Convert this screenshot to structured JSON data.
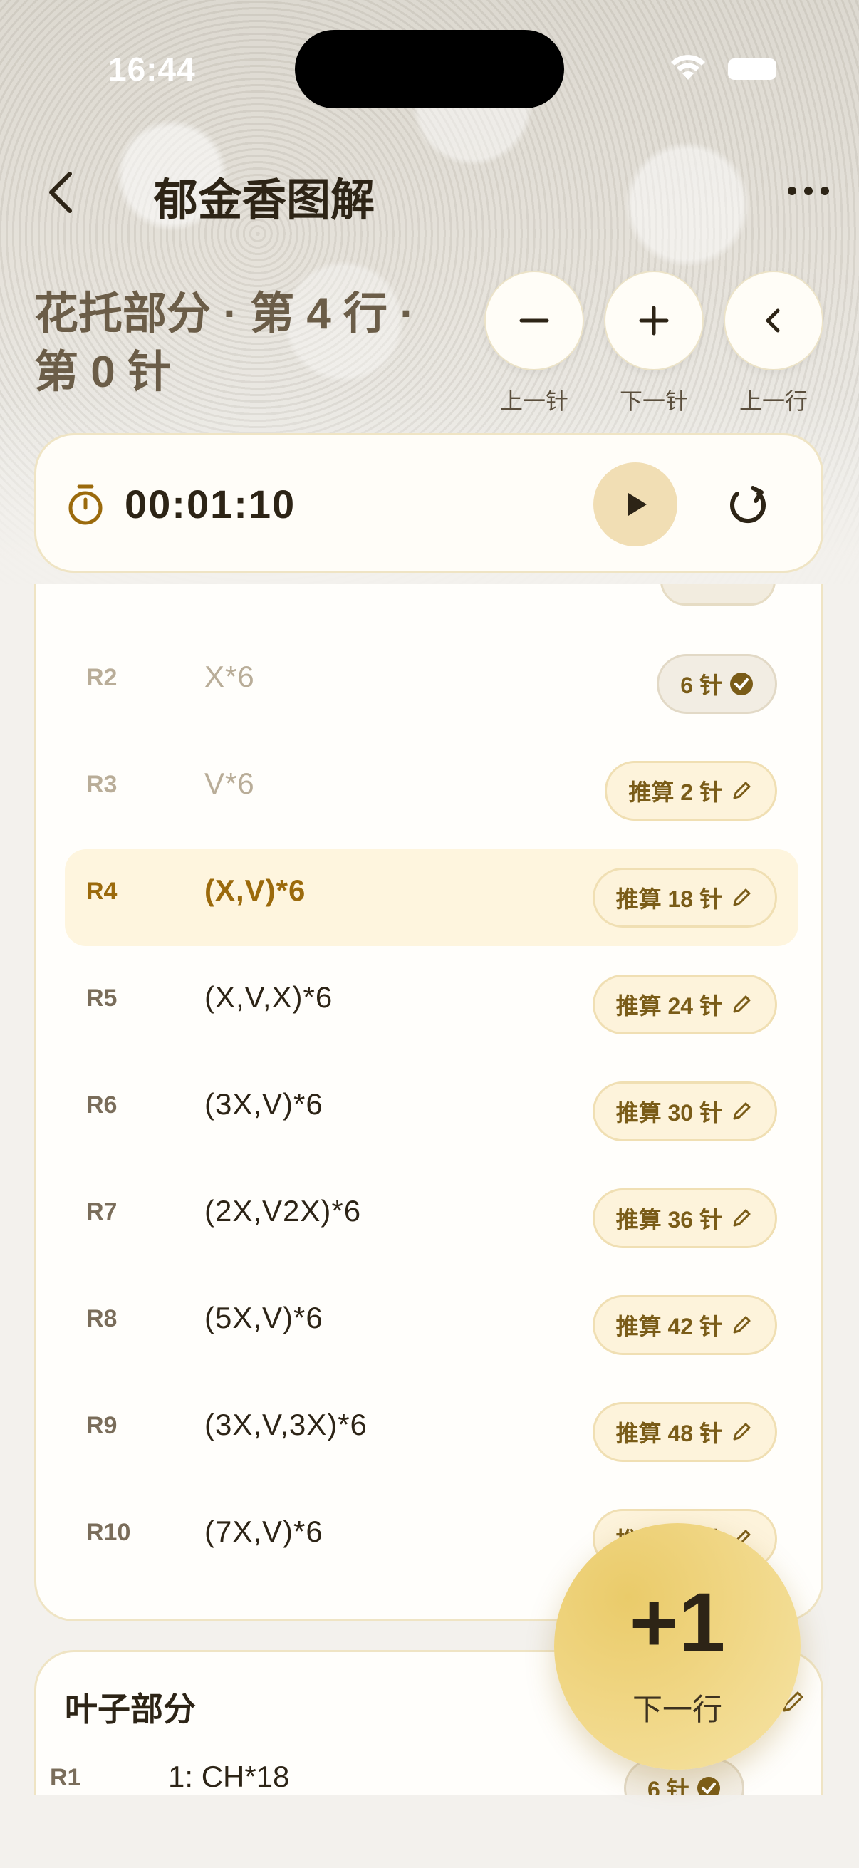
{
  "status_bar": {
    "time": "16:44"
  },
  "header": {
    "title": "郁金香图解"
  },
  "progress": {
    "title": "花托部分 · 第 4 行 · 第 0 针"
  },
  "controls": [
    {
      "label": "上一针",
      "icon": "minus-icon"
    },
    {
      "label": "下一针",
      "icon": "plus-icon"
    },
    {
      "label": "上一行",
      "icon": "chevron-left-icon"
    }
  ],
  "timer": {
    "value": "00:01:10",
    "play_icon": "play-icon",
    "reset_icon": "reset-icon"
  },
  "rows": [
    {
      "label": "R2",
      "pattern": "X*6",
      "chip": "6 针",
      "state": "done"
    },
    {
      "label": "R3",
      "pattern": "V*6",
      "chip": "推算 2 针",
      "state": "done-pending"
    },
    {
      "label": "R4",
      "pattern": "(X,V)*6",
      "chip": "推算 18 针",
      "state": "active"
    },
    {
      "label": "R5",
      "pattern": "(X,V,X)*6",
      "chip": "推算 24 针",
      "state": "todo"
    },
    {
      "label": "R6",
      "pattern": "(3X,V)*6",
      "chip": "推算 30 针",
      "state": "todo"
    },
    {
      "label": "R7",
      "pattern": "(2X,V2X)*6",
      "chip": "推算 36 针",
      "state": "todo"
    },
    {
      "label": "R8",
      "pattern": "(5X,V)*6",
      "chip": "推算 42 针",
      "state": "todo"
    },
    {
      "label": "R9",
      "pattern": "(3X,V,3X)*6",
      "chip": "推算 48 针",
      "state": "todo"
    },
    {
      "label": "R10",
      "pattern": "(7X,V)*6",
      "chip": "推算 54 针",
      "state": "todo"
    }
  ],
  "leaf_section": {
    "title": "叶子部分",
    "row": {
      "label": "R1",
      "pattern": "1: CH*18",
      "chip": "6 针"
    }
  },
  "fab": {
    "value": "+1",
    "label": "下一行"
  },
  "colors": {
    "accent": "#f0d684",
    "active_row": "#fef5de",
    "chip_bg": "#fdf3db",
    "active_text": "#9b6a0c"
  }
}
